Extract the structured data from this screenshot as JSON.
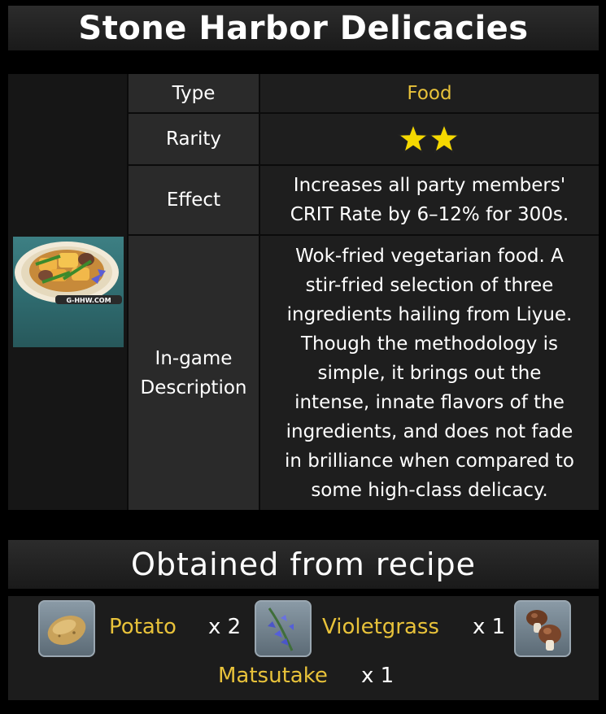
{
  "title": "Stone Harbor Delicacies",
  "image_watermark": "G-HHW.COM",
  "rows": {
    "type": {
      "label": "Type",
      "value": "Food"
    },
    "rarity": {
      "label": "Rarity",
      "stars": 2,
      "star_color": "#f5d800"
    },
    "effect": {
      "label": "Effect",
      "value_line1": "Increases all party members'",
      "value_line2": "CRIT Rate by 6–12% for 300s."
    },
    "description": {
      "label_line1": "In-game",
      "label_line2": "Description",
      "lines": [
        "Wok-fried vegetarian food. A",
        "stir-fried selection of three",
        "ingredients hailing from Liyue.",
        "Though the methodology is",
        "simple, it brings out the",
        "intense, innate flavors of the",
        "ingredients, and does not fade",
        "in brilliance when compared to",
        "some high-class delicacy."
      ]
    }
  },
  "recipe": {
    "heading": "Obtained from recipe",
    "ingredients": [
      {
        "name": "Potato",
        "qty": "x 2",
        "icon": "potato-icon"
      },
      {
        "name": "Violetgrass",
        "qty": "x 1",
        "icon": "violetgrass-icon"
      },
      {
        "name": "Matsutake",
        "qty": "x 1",
        "icon": "matsutake-icon"
      }
    ]
  },
  "colors": {
    "accent_gold": "#e8c23a",
    "panel": "#1e1e1e",
    "label_cell": "#2a2a2a"
  }
}
